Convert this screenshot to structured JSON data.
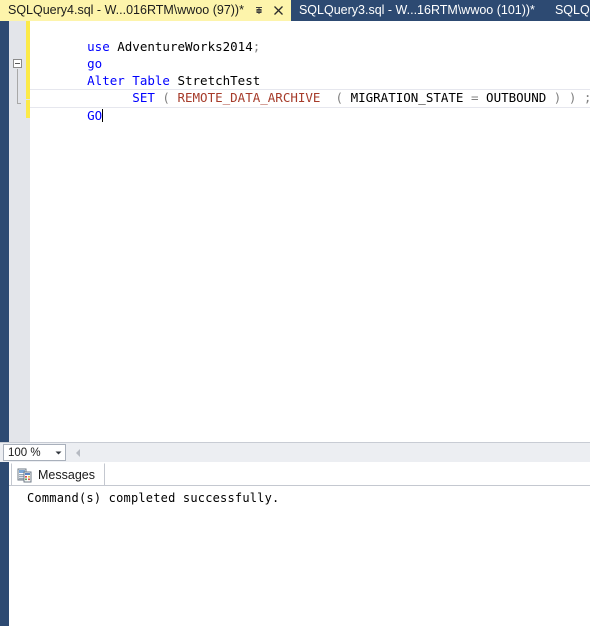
{
  "tabs": [
    {
      "label": "SQLQuery4.sql - W...016RTM\\wwoo (97))*",
      "active": true,
      "pin_icon": "pin-icon",
      "close_icon": "close-icon"
    },
    {
      "label": "SQLQuery3.sql - W...16RTM\\wwoo (101))*",
      "active": false
    },
    {
      "label": "SQLQuer",
      "active": false
    }
  ],
  "editor": {
    "lines": [
      {
        "tokens": [
          {
            "text": "use",
            "style": "kw"
          },
          {
            "text": " AdventureWorks2014",
            "style": "ident"
          },
          {
            "text": ";",
            "style": "punc"
          }
        ]
      },
      {
        "tokens": [
          {
            "text": "go",
            "style": "kw"
          }
        ]
      },
      {
        "tokens": [
          {
            "text": "Alter Table",
            "style": "kw"
          },
          {
            "text": " StretchTest",
            "style": "ident"
          }
        ]
      },
      {
        "tokens": [
          {
            "text": "      SET",
            "style": "kw"
          },
          {
            "text": " ( ",
            "style": "punc"
          },
          {
            "text": "REMOTE_DATA_ARCHIVE",
            "style": "fn"
          },
          {
            "text": "  ( ",
            "style": "punc"
          },
          {
            "text": "MIGRATION_STATE",
            "style": "ident"
          },
          {
            "text": " = ",
            "style": "punc"
          },
          {
            "text": "OUTBOUND",
            "style": "ident"
          },
          {
            "text": " ) ) ;",
            "style": "punc"
          }
        ]
      },
      {
        "tokens": [
          {
            "text": "GO",
            "style": "kw"
          }
        ]
      }
    ]
  },
  "statusbar": {
    "zoom_value": "100 %",
    "zoom_dropdown_icon": "chevron-down-icon",
    "scroll_left_icon": "scroll-left-icon"
  },
  "results": {
    "tab_label": "Messages",
    "tab_icon": "messages-icon",
    "message": "Command(s) completed successfully."
  },
  "colors": {
    "tab_active_bg": "#fdf4ab",
    "tab_inactive_bg": "#2d4a72",
    "keyword": "#0000ff",
    "function": "#a63b2a",
    "punctuation": "#808080",
    "changebar": "#fcea48",
    "chrome": "#2d4a72"
  }
}
